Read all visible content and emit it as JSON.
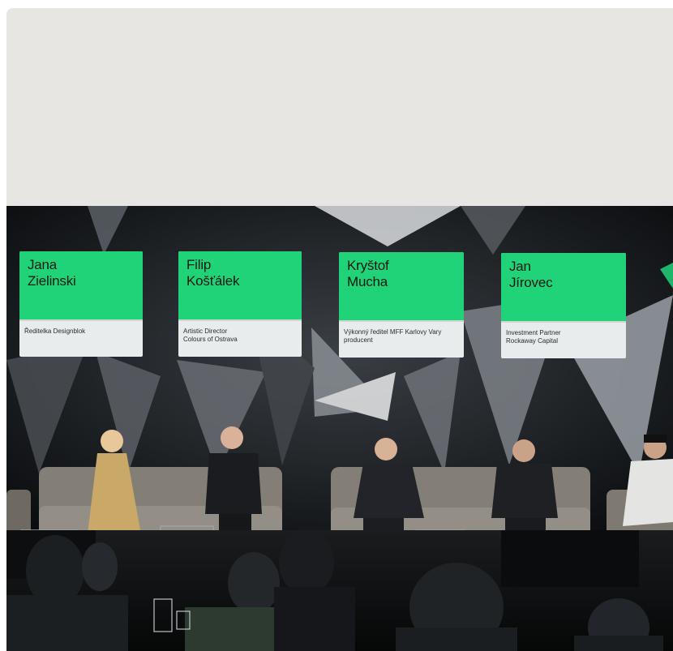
{
  "speakers": [
    {
      "first": "Jana",
      "last": "Zielinski",
      "role_line1": "Ředitelka Designblok",
      "role_line2": ""
    },
    {
      "first": "Filip",
      "last": "Košťálek",
      "role_line1": "Artistic Director",
      "role_line2": "Colours of Ostrava"
    },
    {
      "first": "Kryštof",
      "last": "Mucha",
      "role_line1": "Výkonný ředitel MFF Karlovy Vary",
      "role_line2": "producent"
    },
    {
      "first": "Jan",
      "last": "Jírovec",
      "role_line1": "Investment Partner",
      "role_line2": "Rockaway Capital"
    }
  ],
  "colors": {
    "placeholder": "#e7e6e3",
    "card_green": "#20d278",
    "stage_dark": "#101214"
  }
}
